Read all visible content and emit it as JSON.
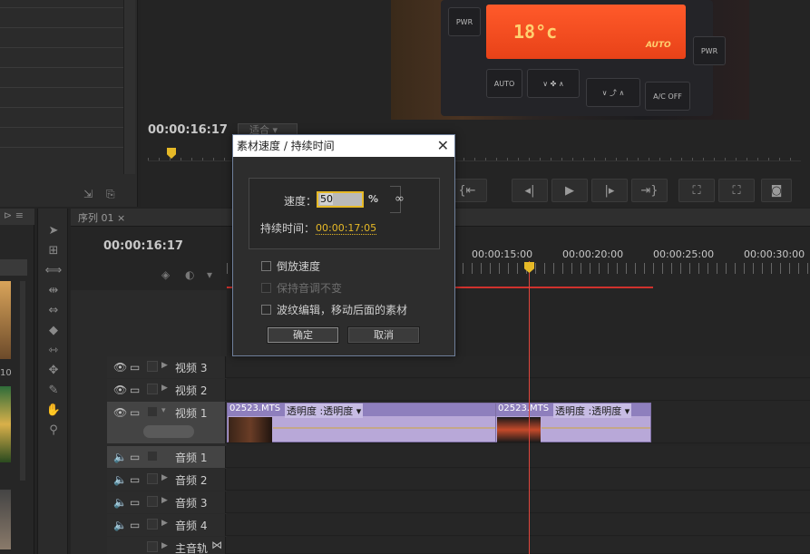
{
  "program_monitor": {
    "timecode": "00:00:16:17",
    "fit_label": "适合",
    "lcd_temp": "18°c",
    "lcd_mode": "AUTO",
    "console_buttons": [
      "PWR",
      "PWR",
      "AUTO",
      "∨ ✤ ∧",
      "∨ ⤴ ∧",
      "A/C OFF"
    ]
  },
  "timeline": {
    "tab_label": "序列 01",
    "timecode": "00:00:16:17",
    "ruler_labels": [
      "00:00:15:00",
      "00:00:20:00",
      "00:00:25:00",
      "00:00:30:00"
    ],
    "tracks": [
      {
        "name": "视频 3",
        "type": "video"
      },
      {
        "name": "视频 2",
        "type": "video"
      },
      {
        "name": "视频 1",
        "type": "video"
      },
      {
        "name": "音频 1",
        "type": "audio"
      },
      {
        "name": "音频 2",
        "type": "audio"
      },
      {
        "name": "音频 3",
        "type": "audio"
      },
      {
        "name": "音频 4",
        "type": "audio"
      },
      {
        "name": "主音轨",
        "type": "master"
      }
    ],
    "clips": [
      {
        "name": "02523.MTS",
        "effect": "透明度 :透明度 ▾"
      },
      {
        "name": "02523.MTS",
        "effect": "透明度 :透明度 ▾"
      }
    ]
  },
  "dialog": {
    "title": "素材速度 / 持续时间",
    "close": "✕",
    "speed_label": "速度：",
    "speed_value": "50",
    "speed_unit": "%",
    "link_icon": "∞",
    "duration_label": "持续时间：",
    "duration_value": "00:00:17:05",
    "reverse_label": "倒放速度",
    "keep_pitch_label": "保持音调不变",
    "ripple_label": "波纹编辑，移动后面的素材",
    "ok_label": "确定",
    "cancel_label": "取消"
  },
  "colors": {
    "accent": "#e6b927",
    "playhead": "#e0463c",
    "clip": "#b8a8d8"
  }
}
